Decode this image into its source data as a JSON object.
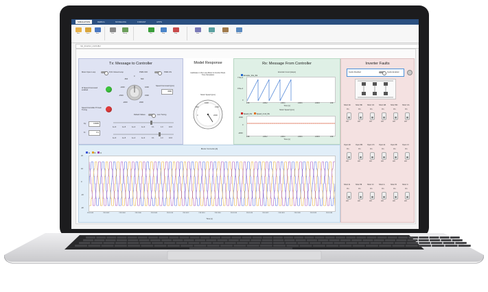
{
  "ribbon": {
    "tabs": [
      "SIMULATION",
      "DEBUG",
      "MODELING",
      "FORMAT",
      "APPS"
    ],
    "buttons": [
      "New",
      "Open",
      "Save",
      "Print",
      "Library",
      "Run",
      "Step",
      "Stop",
      "Data",
      "Logic",
      "Review",
      "Results"
    ],
    "address": "rcp_inverter_controller"
  },
  "tx": {
    "title": "Tx: Message to Controller",
    "closed_loop": "Motor Open Loop",
    "foc_closed": "FOC Closed Loop",
    "pwm_off": "PWM OFF",
    "pwm_on": "PWM ON",
    "id_speed_label": "Id Speed Command enabled",
    "speed_cmd_label": "Speed Command [rpm]",
    "speed_cmd_value": "1500",
    "speed_pi_label": "Speed Controller PI Gain Tuning",
    "default_values": "Default Values",
    "live_tuning": "Live Tuning",
    "kp_label": "Kp",
    "kp_value": "0.0005",
    "ki_label": "Ki",
    "ki_value": "0.1",
    "knob_ticks": [
      "-2000",
      "-1500",
      "-1000",
      "-500",
      "0",
      "500",
      "1000",
      "1500",
      "2000"
    ],
    "slider_ticks": [
      "1e-6",
      "1e-5",
      "1e-4",
      "1e-3",
      "0.1",
      "1.0",
      "10.0"
    ]
  },
  "model": {
    "title": "Model Response",
    "note": "Hardware in the Loop Motor & Inverter Real-Time Simulation",
    "gauge_label": "Motor Speed [rpm]",
    "gauge_ticks": [
      "0",
      "500",
      "1000",
      "1500",
      "2000"
    ]
  },
  "rx": {
    "title": "Rx: Message From Controller",
    "encoder_title": "Encoder Count [steps]",
    "encoder_legend": "Encoder_Pos_fbk",
    "encoder_yticks": [
      "7.5e+4",
      "0.5e+4",
      "0"
    ],
    "encoder_xticks": [
      "218",
      "218.2",
      "218.4",
      "218.6",
      "218.8",
      "219"
    ],
    "speed_title": "Motor Speed [rpm]",
    "speed_legend_1": "Speed_fbk",
    "speed_legend_2": "Speed_Cmd_fbk",
    "speed_yticks": [
      "2000",
      "0",
      "-2000"
    ],
    "speed_xticks": [
      "218",
      "218.2",
      "218.4",
      "218.6",
      "218.8",
      "219"
    ],
    "time_label": "Time [s]"
  },
  "currents": {
    "title": "Motor Currents [A]",
    "legend": [
      "Ia",
      "Ib",
      "Ic"
    ],
    "yticks": [
      "20",
      "10",
      "0",
      "-10",
      "-20"
    ],
    "xticks": [
      "218.1000",
      "218.1002",
      "218.1004",
      "218.1006",
      "218.1008",
      "218.1010",
      "218.1012",
      "218.1014",
      "218.1016",
      "218.1018",
      "218.1020",
      "218.1022",
      "218.1024",
      "218.1026",
      "218.1028",
      "218.1030"
    ],
    "xlabel": "Time [s]"
  },
  "faults": {
    "title": "Inverter Faults",
    "faults_disabled": "Faults Disabled",
    "faults_enabled": "Faults Enabled",
    "row1": [
      "Short Ah",
      "Short Bh",
      "Short Ch",
      "Short AB",
      "Short BC",
      "Short CA"
    ],
    "row2": [
      "Open Ah",
      "Open Bh",
      "Open Ch",
      "Open Al",
      "Open Bl",
      "Open Cl"
    ],
    "row3": [
      "Short Al",
      "Short Bl",
      "Short Cl",
      "Short A",
      "Short B",
      "Short C"
    ],
    "on": "On",
    "off": "Off"
  },
  "colors": {
    "ia": "#3b55d8",
    "ib": "#e0a020",
    "ic": "#9b3bb0",
    "encoder": "#2266cc",
    "speed_fbk": "#cc2222",
    "speed_cmd": "#e07020",
    "lamp_green": "#3cc43c",
    "lamp_red": "#e03a3a"
  }
}
